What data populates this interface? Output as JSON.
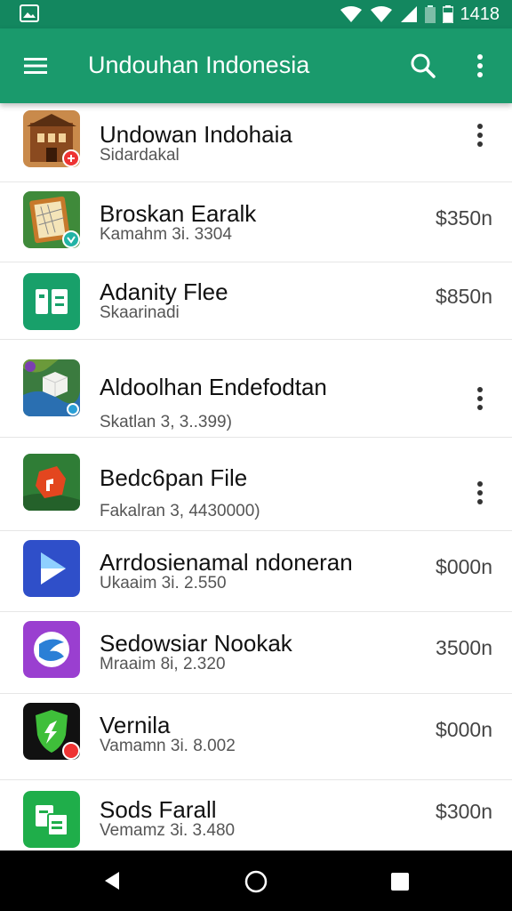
{
  "status_bar": {
    "time": "1418",
    "left_icon": "image-notification-icon",
    "right_icons": [
      "wifi-icon",
      "wifi-icon",
      "signal-icon",
      "battery-icon"
    ]
  },
  "app_bar": {
    "title": "Undouhan Indonesia",
    "menu_icon": "hamburger-menu-icon",
    "search_icon": "search-icon",
    "overflow_icon": "overflow-menu-icon",
    "color": "#1a9a6c"
  },
  "items": [
    {
      "title": "Undowan Indohaia",
      "subtitle": "Sidardakal",
      "price": "",
      "has_menu": true
    },
    {
      "title": "Broskan Earalk",
      "subtitle": "Kamahm 3i. 3304",
      "price": "$350n",
      "has_menu": false
    },
    {
      "title": "Adanity Flee",
      "subtitle": "Skaarinadi",
      "price": "$850n",
      "has_menu": false
    },
    {
      "title": "Aldoolhan Endefodtan",
      "subtitle": "Skatlan 3, 3..399)",
      "price": "",
      "has_menu": true
    },
    {
      "title": "Bedc6pan File",
      "subtitle": "Fakalran 3, 4430000)",
      "price": "",
      "has_menu": true
    },
    {
      "title": "Arrdosienamal ndoneran",
      "subtitle": "Ukaaim 3i. 2.550",
      "price": "$000n",
      "has_menu": false
    },
    {
      "title": "Sedowsiar Nookak",
      "subtitle": "Mraaim 8i, 2.320",
      "price": "3500n",
      "has_menu": false
    },
    {
      "title": "Vernila",
      "subtitle": "Vamamn 3i. 8.002",
      "price": "$000n",
      "has_menu": false
    },
    {
      "title": "Sods Farall",
      "subtitle": "Vemamz 3i. 3.480",
      "price": "$300n",
      "has_menu": false
    }
  ],
  "nav_bar": {
    "back_icon": "back-triangle-icon",
    "home_icon": "home-circle-icon",
    "recents_icon": "recents-square-icon"
  }
}
